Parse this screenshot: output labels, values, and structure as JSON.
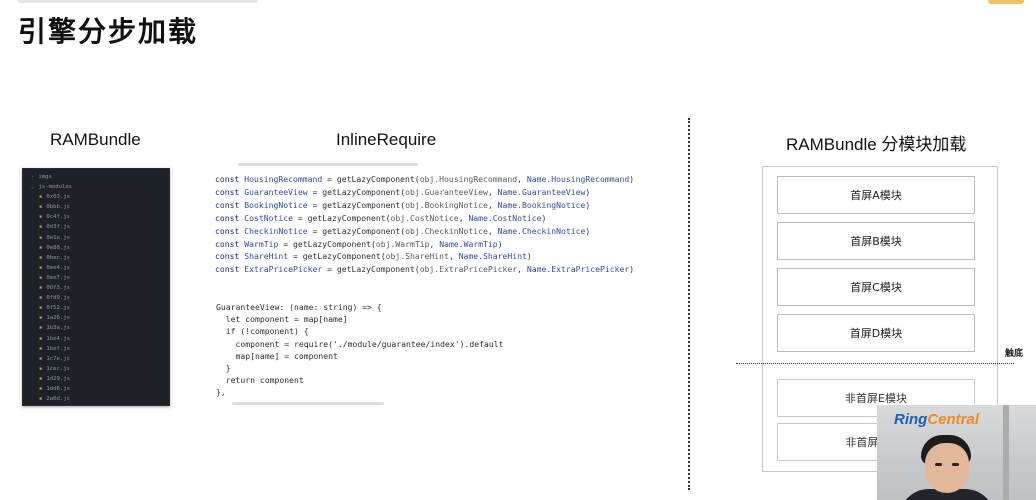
{
  "slide": {
    "title": "引擎分步加载"
  },
  "columns": {
    "left_title": "RAMBundle",
    "middle_title": "InlineRequire",
    "right_title": "RAMBundle 分模块加载"
  },
  "file_tree": {
    "folders": [
      {
        "twisty": "›",
        "name": "imgs"
      },
      {
        "twisty": "⌄",
        "name": "js-modules"
      }
    ],
    "files": [
      "0x03.js",
      "0bbb.js",
      "0c4f.js",
      "0d3f.js",
      "0e1e.js",
      "0e88.js",
      "0bec.js",
      "0ee4.js",
      "0ee7.js",
      "0Of3.js",
      "0fd9.js",
      "0f52.js",
      "1a26.js",
      "1b3a.js",
      "1be4.js",
      "1bef.js",
      "1c7e.js",
      "1cec.js",
      "1d29.js",
      "1dd6.js",
      "2a0d.js"
    ]
  },
  "code_top": {
    "lines": [
      {
        "kw": "const ",
        "name": "HousingRecommand",
        "mid": " = getLazyComponent(",
        "obj": "obj.HousingRecommand",
        "sep": ", ",
        "nm": "Name.HousingRecommand",
        "end": ")"
      },
      {
        "kw": "const ",
        "name": "GuaranteeView",
        "mid": " = getLazyComponent(",
        "obj": "obj.GuaranteeView",
        "sep": ", ",
        "nm": "Name.GuaranteeView",
        "end": ")"
      },
      {
        "kw": "const ",
        "name": "BookingNotice",
        "mid": " = getLazyComponent(",
        "obj": "obj.BookingNotice",
        "sep": ", ",
        "nm": "Name.BookingNotice",
        "end": ")"
      },
      {
        "kw": "const ",
        "name": "CostNotice",
        "mid": " = getLazyComponent(",
        "obj": "obj.CostNotice",
        "sep": ", ",
        "nm": "Name.CostNotice",
        "end": ")"
      },
      {
        "kw": "const ",
        "name": "CheckinNotice",
        "mid": " = getLazyComponent(",
        "obj": "obj.CheckinNotice",
        "sep": ", ",
        "nm": "Name.CheckinNotice",
        "end": ")"
      },
      {
        "kw": "const ",
        "name": "WarmTip",
        "mid": " = getLazyComponent(",
        "obj": "obj.WarmTip",
        "sep": ", ",
        "nm": "Name.WarmTip",
        "end": ")"
      },
      {
        "kw": "const ",
        "name": "ShareHint",
        "mid": " = getLazyComponent(",
        "obj": "obj.ShareHint",
        "sep": ", ",
        "nm": "Name.ShareHint",
        "end": ")"
      },
      {
        "kw": "const ",
        "name": "ExtraPricePicker",
        "mid": " = getLazyComponent(",
        "obj": "obj.ExtraPricePicker",
        "sep": ", ",
        "nm": "Name.ExtraPricePicker",
        "end": ")"
      }
    ]
  },
  "code_bottom": {
    "lines": [
      "GuaranteeView: (name: string) => {",
      "  let component = map[name]",
      "  if (!component) {",
      "    component = require('./module/guarantee/index').default",
      "    map[name] = component",
      "  }",
      "  return component",
      "},"
    ]
  },
  "modules": {
    "first_screen": [
      "首屏A模块",
      "首屏B模块",
      "首屏C模块",
      "首屏D模块"
    ],
    "non_first_screen": [
      "非首屏E模块",
      "非首屏F模块"
    ],
    "fold_label": "触底"
  },
  "webcam": {
    "brand_part1": "Ring",
    "brand_part2": "Central"
  }
}
